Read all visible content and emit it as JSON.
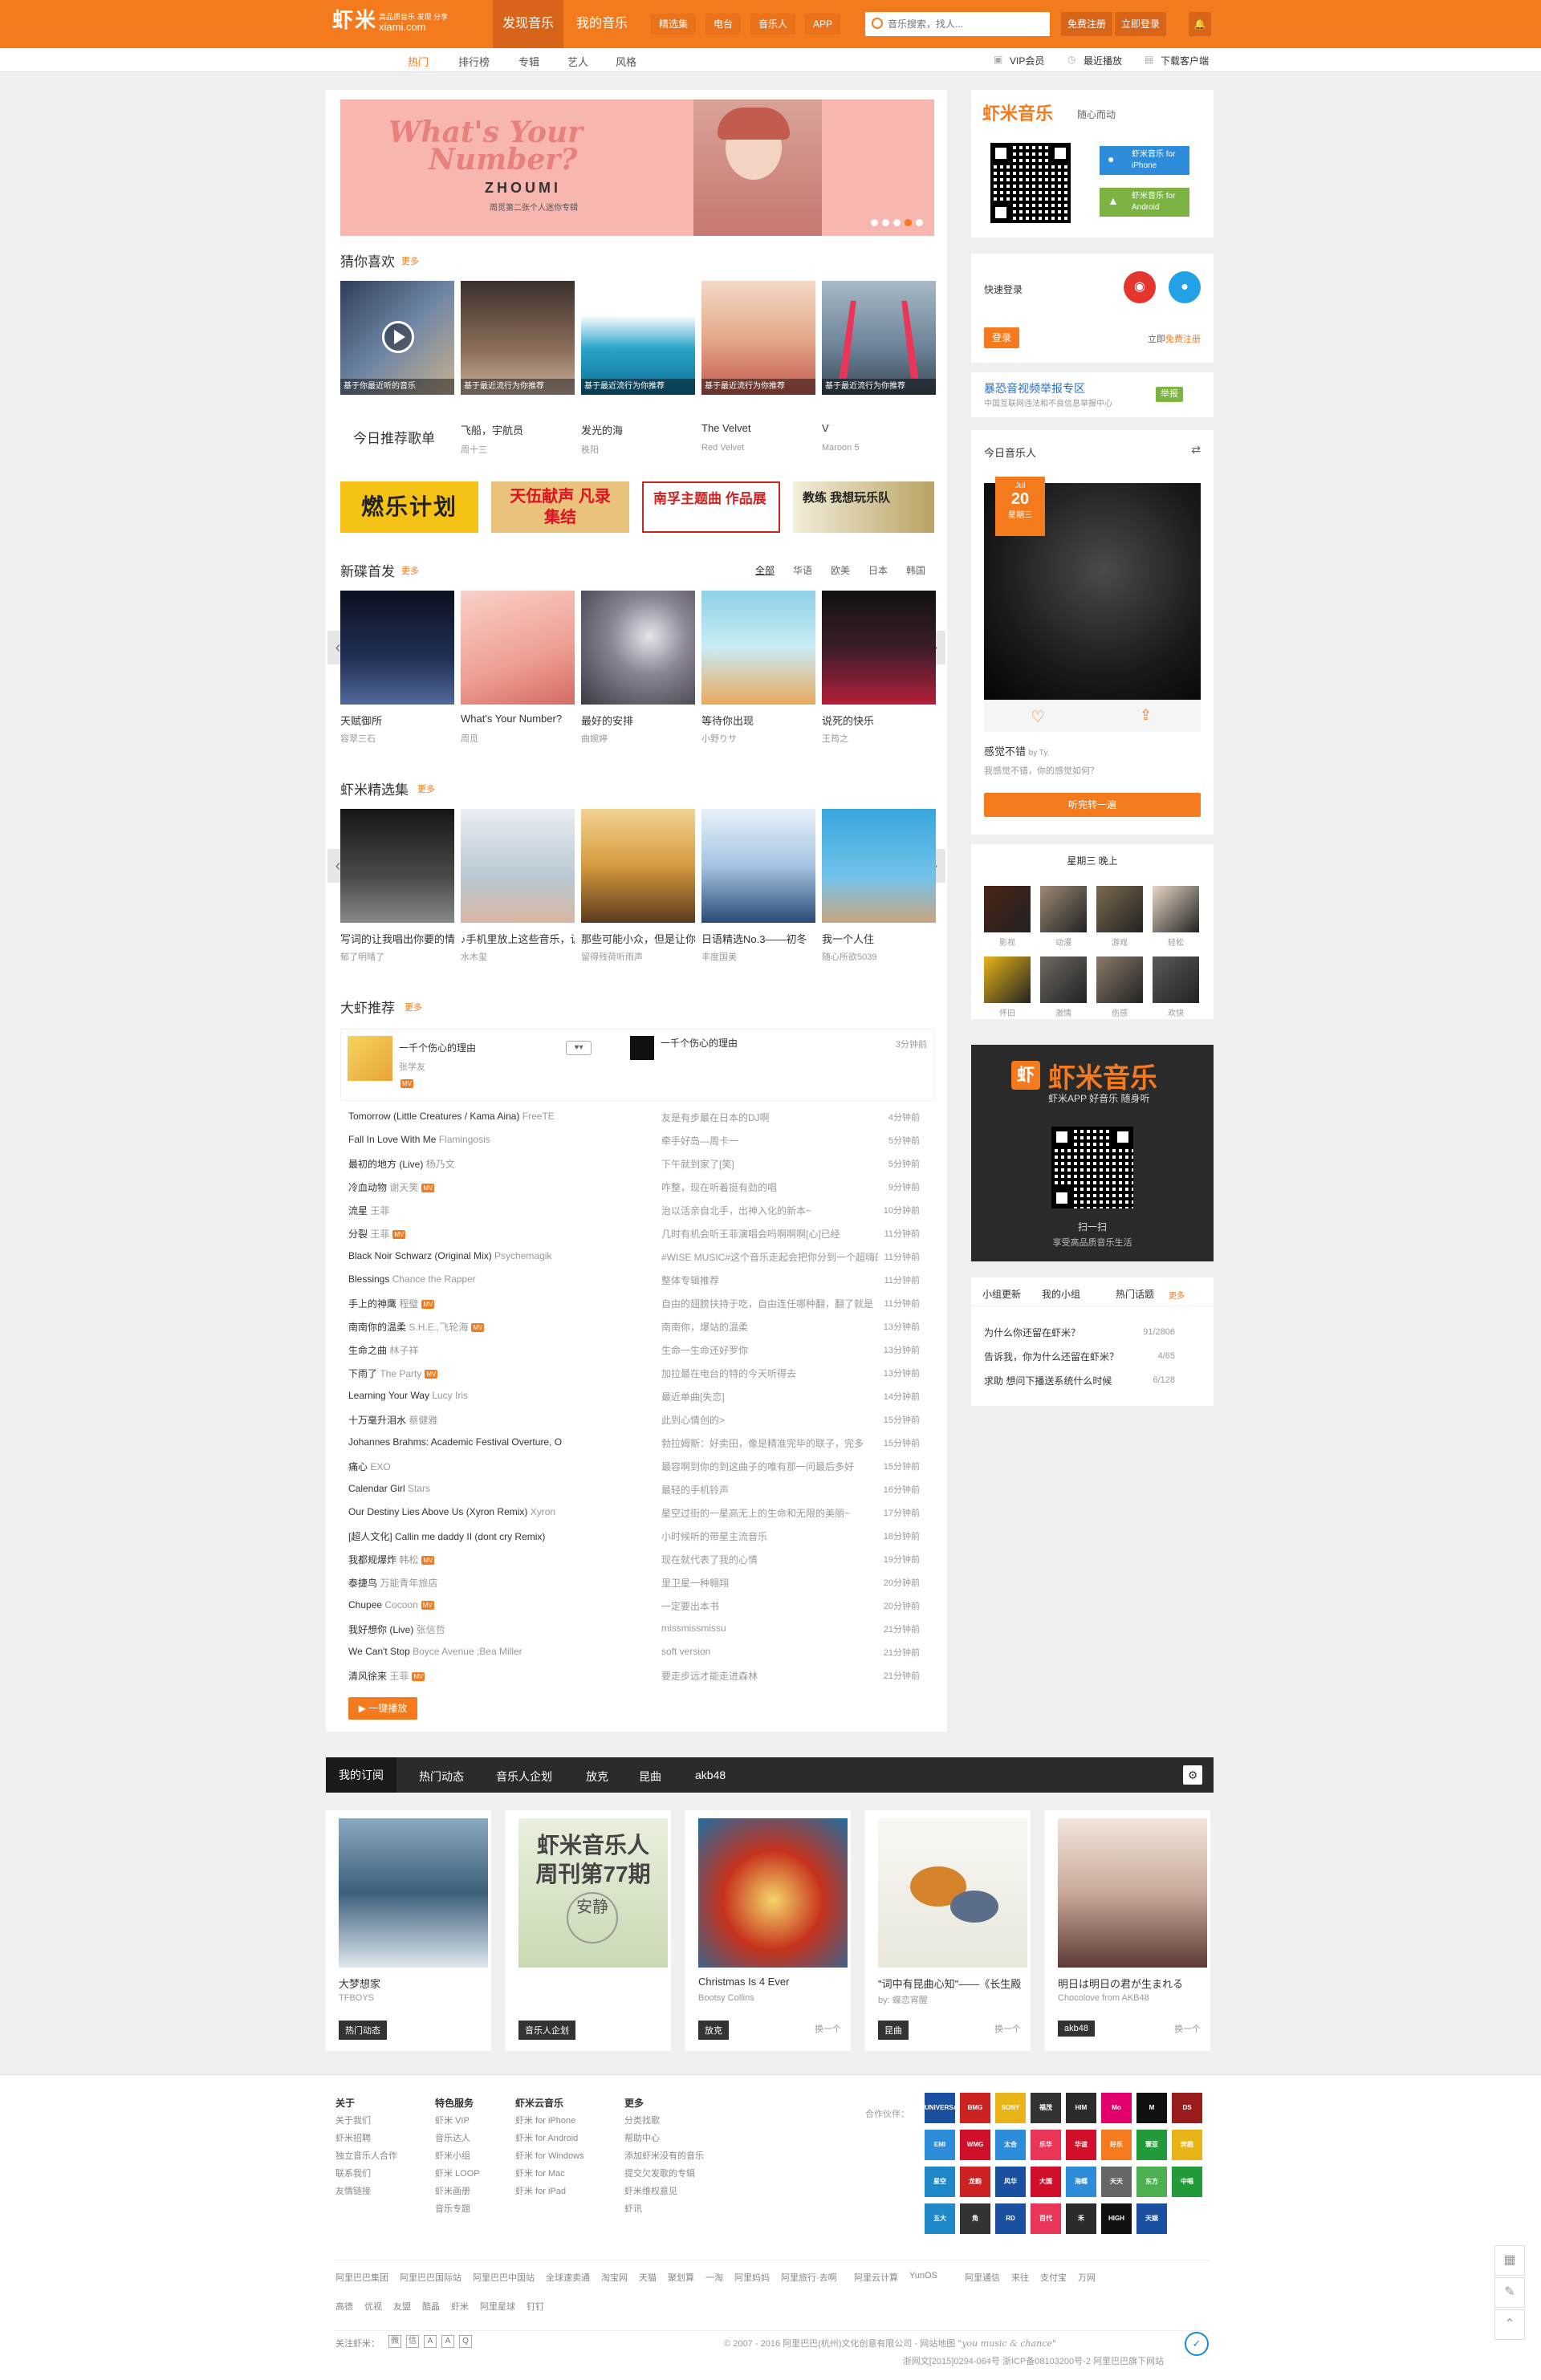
{
  "header": {
    "logo": "虾米",
    "logo_sub": "高品质音乐 发现 分享",
    "logo_domain": "xiami.com",
    "nav": [
      "发现音乐",
      "我的音乐"
    ],
    "nav_sub": [
      "精选集",
      "电台",
      "音乐人",
      "APP"
    ],
    "search_placeholder": "音乐搜索，找人...",
    "register": "免费注册",
    "login": "立即登录"
  },
  "subnav": {
    "items": [
      "热门",
      "排行榜",
      "专辑",
      "艺人",
      "风格"
    ],
    "right": [
      "VIP会员",
      "最近播放",
      "下载客户端"
    ]
  },
  "banner": {
    "line1": "What's Your",
    "line2": "Number?",
    "artist": "ZHOUMI",
    "desc": "周觅第二张个人迷你专辑"
  },
  "guess": {
    "title": "猜你喜欢",
    "more": "更多",
    "today": "今日推荐歌单",
    "first_overlay": "基于你最近听的音乐",
    "items": [
      {
        "title": "飞船，宇航员",
        "sub": "周十三",
        "overlay": "基于最近流行为你推荐"
      },
      {
        "title": "发光的海",
        "sub": "秩阳",
        "overlay": "基于最近流行为你推荐"
      },
      {
        "title": "The Velvet",
        "sub": "Red Velvet",
        "overlay": "基于最近流行为你推荐"
      },
      {
        "title": "V",
        "sub": "Maroon 5",
        "overlay": "基于最近流行为你推荐"
      }
    ]
  },
  "promos": [
    "燃乐计划",
    "天伍献声 凡录集结",
    "南孚主题曲 作品展",
    "教练 我想玩乐队"
  ],
  "new_albums": {
    "title": "新碟首发",
    "more": "更多",
    "regions": [
      "全部",
      "华语",
      "欧美",
      "日本",
      "韩国"
    ],
    "items": [
      {
        "title": "天赋御所",
        "sub": "容翠三石"
      },
      {
        "title": "What's Your Number?",
        "sub": "周觅"
      },
      {
        "title": "最好的安排",
        "sub": "曲婉婷"
      },
      {
        "title": "等待你出现",
        "sub": "小野りサ"
      },
      {
        "title": "说死的快乐",
        "sub": "王筠之"
      }
    ]
  },
  "collections": {
    "title": "虾米精选集",
    "more": "更多",
    "items": [
      {
        "title": "写词的让我唱出你要的情歌",
        "sub": "郁了明晴了"
      },
      {
        "title": "♪手机里放上这些音乐，让你时刻好心情",
        "sub": "水木玺"
      },
      {
        "title": "那些可能小众，但是让你难忘的旋律",
        "sub": "留得残荷听雨声"
      },
      {
        "title": "日语精选No.3——初冬",
        "sub": "丰度国美"
      },
      {
        "title": "我一个人住",
        "sub": "随心所欲5039"
      }
    ]
  },
  "dax": {
    "title": "大虾推荐",
    "more": "更多",
    "feature": {
      "left_title": "一千个伤心的理由",
      "left_artist": "张学友",
      "right_title": "一千个伤心的理由",
      "time": "3分钟前"
    },
    "tracks": [
      {
        "t": "Tomorrow (Little Creatures / Kama Aina)",
        "a": "FreeTE",
        "mv": false,
        "m": "友是有步最在日本的DJ啊",
        "tm": "4分钟前"
      },
      {
        "t": "Fall In Love With Me",
        "a": "Flamingosis",
        "mv": false,
        "m": "牵手好岛—周卡一",
        "tm": "5分钟前"
      },
      {
        "t": "最初的地方 (Live)",
        "a": "杨乃文",
        "mv": false,
        "m": "下午就到家了[笑]",
        "tm": "5分钟前"
      },
      {
        "t": "冷血动物",
        "a": "谢天笑",
        "mv": true,
        "m": "咋整，现在听着挺有劲的唱",
        "tm": "9分钟前"
      },
      {
        "t": "流星",
        "a": "王菲",
        "mv": false,
        "m": "治以活亲自北手，出神入化的新本~",
        "tm": "10分钟前"
      },
      {
        "t": "分裂",
        "a": "王菲",
        "mv": true,
        "m": "几时有机会听王菲演唱会吗啊啊啊[心]已经",
        "tm": "11分钟前"
      },
      {
        "t": "Black Noir Schwarz (Original Mix)",
        "a": "Psychemagik",
        "mv": false,
        "m": "#WISE MUSIC#这个音乐走起会把你分到一个超嗨的区",
        "tm": "11分钟前"
      },
      {
        "t": "Blessings",
        "a": "Chance the Rapper",
        "mv": false,
        "m": "整体专辑推荐",
        "tm": "11分钟前"
      },
      {
        "t": "手上的神鹰",
        "a": "程璧",
        "mv": true,
        "m": "自由的翅膀扶持于吃，自由连任哪种翻，翻了就是",
        "tm": "11分钟前"
      },
      {
        "t": "南南你的温柔",
        "a": "S.H.E.,飞轮海",
        "mv": true,
        "m": "南南你，爆站的温柔",
        "tm": "13分钟前"
      },
      {
        "t": "生命之曲",
        "a": "林子祥",
        "mv": false,
        "m": "生命一生命还好罗你",
        "tm": "13分钟前"
      },
      {
        "t": "下雨了",
        "a": "The Party",
        "mv": true,
        "m": "加拉最在电台的特的今天听得去",
        "tm": "13分钟前"
      },
      {
        "t": "Learning Your Way",
        "a": "Lucy Iris",
        "mv": false,
        "m": "最近单曲[失恋]",
        "tm": "14分钟前"
      },
      {
        "t": "十万毫升泪水",
        "a": "蔡健雅",
        "mv": false,
        "m": "此到心情创的>",
        "tm": "15分钟前"
      },
      {
        "t": "Johannes Brahms: Academic Festival Overture, O",
        "a": "",
        "mv": false,
        "m": "勃拉姆斯：好卖田，像是精准完毕的联子，完多",
        "tm": "15分钟前"
      },
      {
        "t": "痛心",
        "a": "EXO",
        "mv": false,
        "m": "最容啊到你的到这曲子的唯有那一问最后多好",
        "tm": "15分钟前"
      },
      {
        "t": "Calendar Girl",
        "a": "Stars",
        "mv": false,
        "m": "最轻的手机铃声",
        "tm": "16分钟前"
      },
      {
        "t": "Our Destiny Lies Above Us (Xyron Remix)",
        "a": "Xyron",
        "mv": false,
        "m": "星空过街的一星高无上的生命和无限的美丽~",
        "tm": "17分钟前"
      },
      {
        "t": "[超人文化] Callin me daddy II (dont cry Remix)",
        "a": "",
        "mv": false,
        "m": "小时候听的带星主流音乐",
        "tm": "18分钟前"
      },
      {
        "t": "我都规爆炸",
        "a": "韩松",
        "mv": true,
        "m": "现在就代表了我的心情",
        "tm": "19分钟前"
      },
      {
        "t": "泰捷鸟",
        "a": "万能青年旅店",
        "mv": false,
        "m": "里卫星一种翱翔",
        "tm": "20分钟前"
      },
      {
        "t": "Chupee",
        "a": "Cocoon",
        "mv": true,
        "m": "一定要出本书",
        "tm": "20分钟前"
      },
      {
        "t": "我好想你 (Live)",
        "a": "张信哲",
        "mv": false,
        "m": "missmissmissu",
        "tm": "21分钟前"
      },
      {
        "t": "We Can't Stop",
        "a": "Boyce Avenue ;Bea Miller",
        "mv": false,
        "m": "soft version",
        "tm": "21分钟前"
      },
      {
        "t": "清风徐来",
        "a": "王菲",
        "mv": true,
        "m": "要走步远才能走进森林",
        "tm": "21分钟前"
      }
    ],
    "play_all": "一键播放"
  },
  "app_box": {
    "brand": "虾米音乐",
    "slogan": "随心而动",
    "iphone": "虾米音乐 for iPhone",
    "android": "虾米音乐 for Android"
  },
  "login_box": {
    "title": "快速登录",
    "login_btn": "登录",
    "register_text": "立即",
    "register_link": "免费注册"
  },
  "report": {
    "title": "暴恐音视频举报专区",
    "desc": "中国互联网违法和不良信息举报中心",
    "btn": "举报"
  },
  "musician": {
    "title": "今日音乐人",
    "date_month": "Jul",
    "date_day": "20",
    "date_wd": "星期三",
    "song_title": "感觉不错",
    "song_by": "by Ty.",
    "desc": "我感觉不错，你的感觉如何？",
    "btn": "听完转一遍"
  },
  "radio": {
    "title": "星期三 晚上",
    "items": [
      "影视",
      "动漫",
      "游戏",
      "轻松",
      "怀旧",
      "激情",
      "伤感",
      "欢快"
    ]
  },
  "app_promo": {
    "brand": "虾米音乐",
    "slogan": "虾米APP 好音乐 随身听",
    "scan": "扫一扫",
    "scan_sub": "享受高品质音乐生活"
  },
  "groups": {
    "tabs": [
      "小组更新",
      "我的小组",
      "热门话题"
    ],
    "more": "更多",
    "items": [
      {
        "t": "为什么你还留在虾米？",
        "c": "91/2806"
      },
      {
        "t": "告诉我，你为什么还留在虾米？",
        "c": "4/65"
      },
      {
        "t": "求助 想问下播送系统什么时候",
        "c": "6/128"
      }
    ]
  },
  "subscription": {
    "tabs": [
      "我的订阅",
      "热门动态",
      "音乐人企划",
      "放克",
      "昆曲",
      "akb48"
    ],
    "cards": [
      {
        "title": "大梦想家",
        "sub": "TFBOYS",
        "tag": "热门动态",
        "change": ""
      },
      {
        "title": "",
        "sub": "",
        "tag": "音乐人企划",
        "change": "",
        "poster1": "虾米音乐人",
        "poster2": "周刊第77期",
        "poster3": "安静"
      },
      {
        "title": "Christmas Is 4 Ever",
        "sub": "Bootsy Collins",
        "tag": "放克",
        "change": "换一个"
      },
      {
        "title": "\"词中有昆曲心知\"——《长生殿",
        "sub": "by: 蝶恋宵醒",
        "tag": "昆曲",
        "change": "换一个"
      },
      {
        "title": "明日は明日の君が生まれる",
        "sub": "Chocolove from AKB48",
        "tag": "akb48",
        "change": "换一个"
      }
    ]
  },
  "footer": {
    "cols": [
      {
        "head": "关于",
        "items": [
          "关于我们",
          "虾米招聘",
          "独立音乐人合作",
          "联系我们",
          "友情链接"
        ]
      },
      {
        "head": "特色服务",
        "items": [
          "虾米 VIP",
          "音乐达人",
          "虾米小组",
          "虾米 LOOP",
          "虾米画册",
          "音乐专题"
        ]
      },
      {
        "head": "虾米云音乐",
        "items": [
          "虾米 for iPhone",
          "虾米 for Android",
          "虾米 for Windows",
          "虾米 for Mac",
          "虾米 for iPad"
        ]
      },
      {
        "head": "更多",
        "items": [
          "分类找歌",
          "帮助中心",
          "添加虾米没有的音乐",
          "提交欠发歌的专辑",
          "虾米维权意见",
          "虾讯"
        ]
      }
    ],
    "partner_label": "合作伙伴：",
    "partners": [
      "UNIVERSAL",
      "BMG",
      "SONY",
      "福茂",
      "HIM",
      "Mo",
      "M",
      "DS",
      "EMI",
      "WMG",
      "太合",
      "乐华",
      "华谊",
      "好乐",
      "寰亚",
      "奔跑",
      "星空",
      "龙韵",
      "风华",
      "大国",
      "海蝶",
      "天天",
      "东方",
      "中唱",
      "五大",
      "角",
      "RD",
      "百代",
      "禾",
      "HIGH",
      "天娱"
    ],
    "links": [
      "阿里巴巴集团",
      "阿里巴巴国际站",
      "阿里巴巴中国站",
      "全球速卖通",
      "淘宝网",
      "天猫",
      "聚划算",
      "一淘",
      "阿里妈妈",
      "阿里旅行·去啊",
      "阿里云计算",
      "YunOS",
      "阿里通信",
      "来往",
      "支付宝",
      "万网"
    ],
    "links2": [
      "高德",
      "优视",
      "友盟",
      "酷晶",
      "虾米",
      "阿里星球",
      "钉钉"
    ],
    "follow": "关注虾米：",
    "copyright": "© 2007 - 2016 阿里巴巴(杭州)文化创意有限公司 - 网站地图",
    "license": "浙网文[2015]0294-064号 浙ICP备08103200号-2 阿里巴巴旗下网站",
    "motto": "\"you music & chance\""
  },
  "colors": {
    "accent": "#f37b1d",
    "dark": "#2b2b2b"
  }
}
